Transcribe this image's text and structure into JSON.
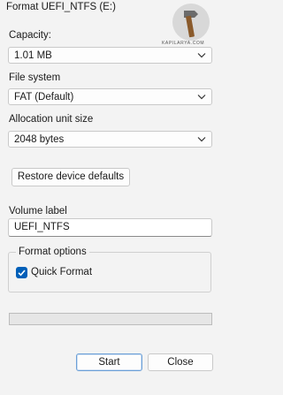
{
  "window": {
    "title": "Format UEFI_NTFS (E:)"
  },
  "watermark": {
    "text": "KAPILARYA.COM",
    "icon": "hammer-icon"
  },
  "capacity": {
    "label": "Capacity:",
    "value": "1.01 MB"
  },
  "file_system": {
    "label": "File system",
    "value": "FAT (Default)"
  },
  "allocation": {
    "label": "Allocation unit size",
    "value": "2048 bytes"
  },
  "restore_label": "Restore device defaults",
  "volume": {
    "label": "Volume label",
    "value": "UEFI_NTFS"
  },
  "format_options": {
    "title": "Format options",
    "quick_format_label": "Quick Format",
    "quick_format_checked": true
  },
  "progress": {
    "fraction": 0
  },
  "buttons": {
    "start": "Start",
    "close": "Close"
  },
  "colors": {
    "accent": "#005fb8",
    "background": "#f3f3f3"
  }
}
